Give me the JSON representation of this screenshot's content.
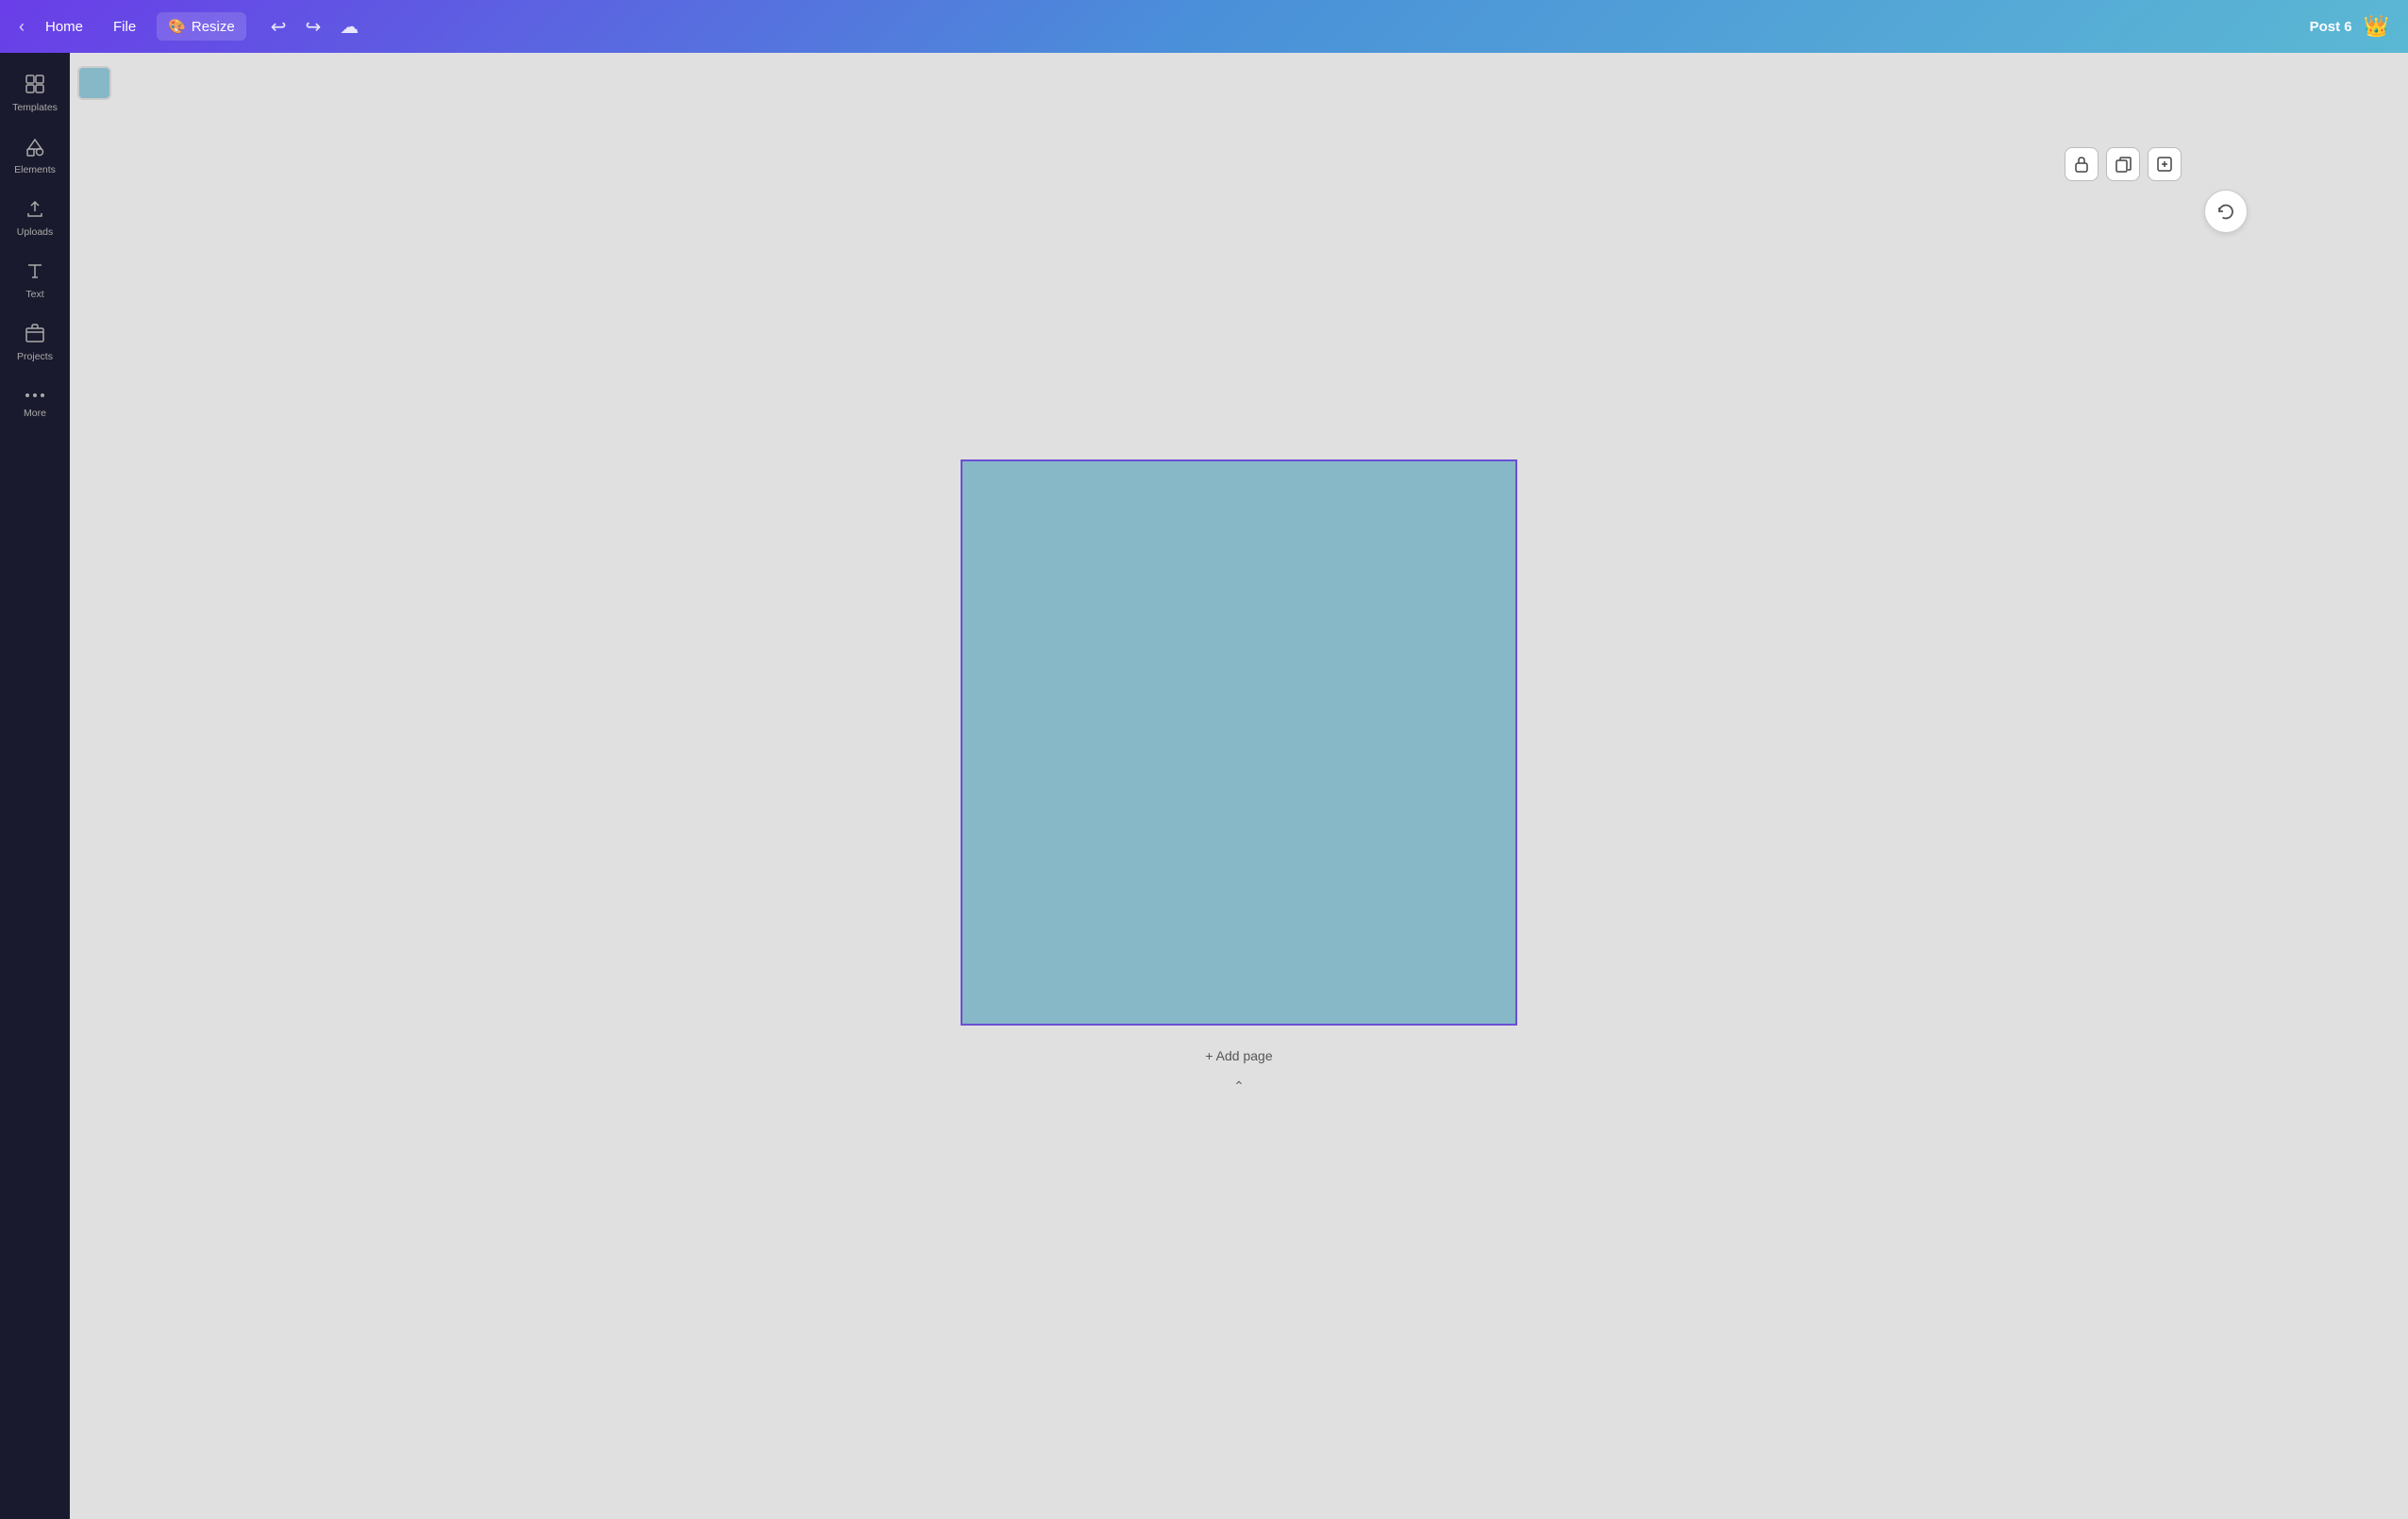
{
  "topbar": {
    "home_label": "Home",
    "file_label": "File",
    "resize_label": "Resize",
    "resize_emoji": "🎨",
    "undo_icon": "↩",
    "redo_icon": "↪",
    "cloud_icon": "☁",
    "title": "Post 6",
    "crown_icon": "👑"
  },
  "sidebar": {
    "items": [
      {
        "id": "templates",
        "label": "Templates",
        "icon": "⊞"
      },
      {
        "id": "elements",
        "label": "Elements",
        "icon": "❤"
      },
      {
        "id": "uploads",
        "label": "Uploads",
        "icon": "⬆"
      },
      {
        "id": "text",
        "label": "Text",
        "icon": "T"
      },
      {
        "id": "projects",
        "label": "Projects",
        "icon": "🗂"
      },
      {
        "id": "more",
        "label": "More",
        "icon": "···"
      }
    ]
  },
  "color_swatch": {
    "color": "#87b8c8"
  },
  "canvas_toolbar": {
    "lock_icon": "🔒",
    "copy_icon": "⧉",
    "add_icon": "+"
  },
  "canvas": {
    "background_color": "#87b8c8",
    "border_color": "#6a4fd4"
  },
  "add_page": {
    "label": "+ Add page"
  },
  "rotate_btn": {
    "icon": "↻"
  }
}
